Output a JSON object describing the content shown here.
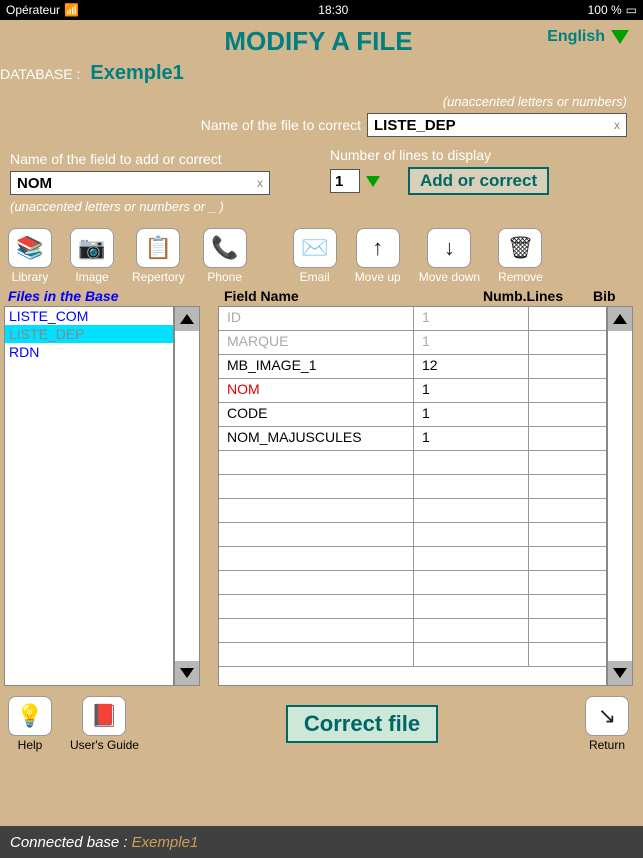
{
  "status": {
    "carrier": "Opérateur",
    "time": "18:30",
    "battery": "100 %"
  },
  "title": "MODIFY A FILE",
  "language": "English",
  "database_label": "DATABASE :",
  "database_value": "Exemple1",
  "file_correct": {
    "hint": "(unaccented letters or numbers)",
    "label": "Name of the file to correct",
    "value": "LISTE_DEP",
    "clear": "x"
  },
  "field_add": {
    "label": "Name of the field to add or correct",
    "value": "NOM",
    "clear": "x",
    "hint": "(unaccented letters or numbers or _ )"
  },
  "num_lines": {
    "label": "Number of lines to display",
    "value": "1"
  },
  "add_button": "Add or correct",
  "toolbar": {
    "library": "Library",
    "image": "Image",
    "repertory": "Repertory",
    "phone": "Phone",
    "email": "Email",
    "moveup": "Move up",
    "movedown": "Move down",
    "remove": "Remove"
  },
  "headers": {
    "files": "Files in the Base",
    "field": "Field Name",
    "num": "Numb.Lines",
    "bib": "Bib"
  },
  "files": [
    "LISTE_COM",
    "LISTE_DEP",
    "RDN"
  ],
  "file_selected_index": 1,
  "fields": [
    {
      "name": "ID",
      "lines": "1",
      "bib": "",
      "dim": true
    },
    {
      "name": "MARQUE",
      "lines": "1",
      "bib": "",
      "dim": true
    },
    {
      "name": "MB_IMAGE_1",
      "lines": "12",
      "bib": ""
    },
    {
      "name": "NOM",
      "lines": "1",
      "bib": "",
      "red": true
    },
    {
      "name": "CODE",
      "lines": "1",
      "bib": ""
    },
    {
      "name": "NOM_MAJUSCULES",
      "lines": "1",
      "bib": ""
    }
  ],
  "bottom": {
    "help": "Help",
    "guide": "User's Guide",
    "correct": "Correct file",
    "return": "Return"
  },
  "footer": {
    "label": "Connected base :",
    "value": "Exemple1"
  }
}
